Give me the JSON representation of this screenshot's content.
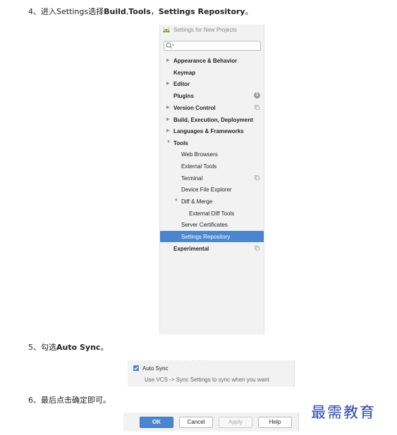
{
  "steps": {
    "step4": {
      "num": "4、",
      "pre": "进入Settings选择",
      "b1": "Build",
      "mid": ",",
      "b2": "Tools",
      "sep": "，",
      "b3": "Settings Repository",
      "end": "。"
    },
    "step5": {
      "num": "5、",
      "pre": "勾选",
      "b1": "Auto Sync",
      "end": "。"
    },
    "step6": {
      "num": "6、",
      "text": "最后点击确定即可。"
    }
  },
  "settings": {
    "title": "Settings for New Projects",
    "search": {
      "placeholder": ""
    },
    "items": [
      {
        "label": "Appearance & Behavior",
        "arrow": "▶"
      },
      {
        "label": "Keymap"
      },
      {
        "label": "Editor",
        "arrow": "▶"
      },
      {
        "label": "Plugins",
        "badge": "1"
      },
      {
        "label": "Version Control",
        "arrow": "▶"
      },
      {
        "label": "Build, Execution, Deployment",
        "arrow": "▶"
      },
      {
        "label": "Languages & Frameworks",
        "arrow": "▶"
      },
      {
        "label": "Tools",
        "arrow": "▼"
      },
      {
        "label": "Web Browsers"
      },
      {
        "label": "External Tools"
      },
      {
        "label": "Terminal"
      },
      {
        "label": "Device File Explorer"
      },
      {
        "label": "Diff & Merge",
        "arrow": "▼"
      },
      {
        "label": "External Diff Tools"
      },
      {
        "label": "Server Certificates"
      },
      {
        "label": "Settings Repository",
        "selected": true
      },
      {
        "label": "Experimental"
      }
    ]
  },
  "sync": {
    "checkbox_label": "Auto Sync",
    "checked": true,
    "description": "Use VCS -> Sync Settings to sync when you want"
  },
  "dialog_buttons": {
    "ok": "OK",
    "cancel": "Cancel",
    "apply": "Apply",
    "help": "Help"
  },
  "watermark": "最需教育",
  "colors": {
    "accent": "#4a86d0",
    "panel_bg": "#f2f2f2",
    "watermark": "#2a44b8"
  }
}
